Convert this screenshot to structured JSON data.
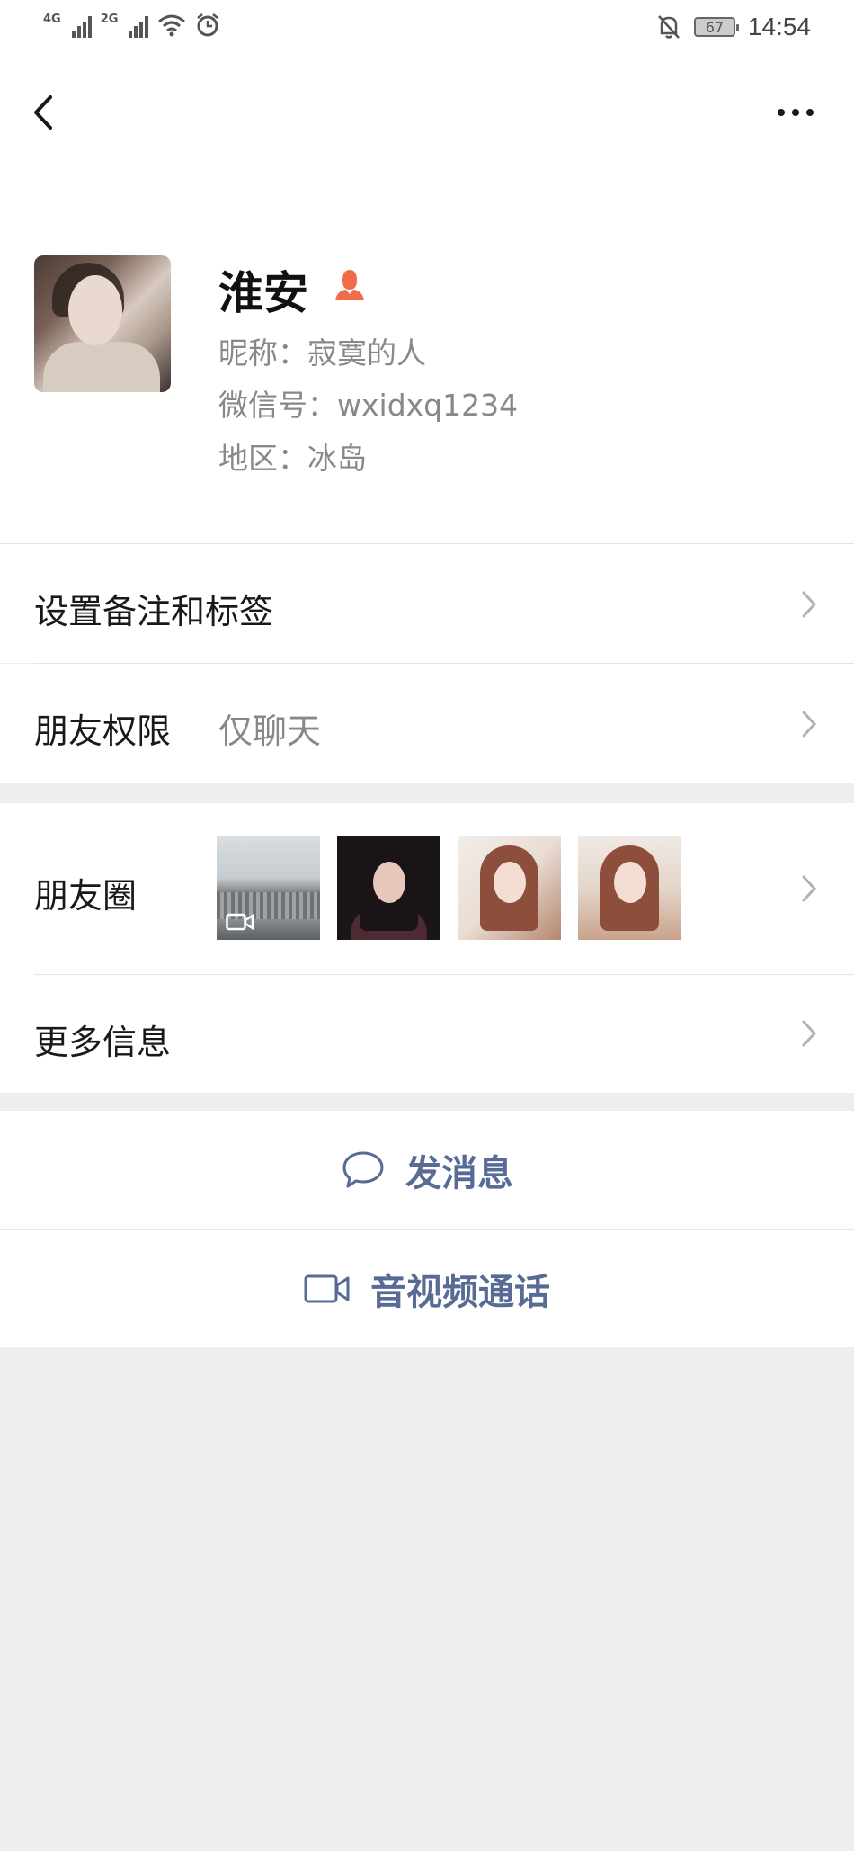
{
  "status_bar": {
    "network_1": "4G",
    "network_2": "2G",
    "battery": "67",
    "time": "14:54"
  },
  "profile": {
    "name": "淮安",
    "nickname": "昵称：寂寞的人",
    "wechat_id": "微信号：wxidxq1234",
    "region": "地区：冰岛"
  },
  "rows": {
    "remark_label": "设置备注和标签",
    "permission_label": "朋友权限",
    "permission_value": "仅聊天",
    "moments_label": "朋友圈",
    "more_info_label": "更多信息"
  },
  "actions": {
    "message": "发消息",
    "call": "音视频通话"
  },
  "colors": {
    "link": "#576b95",
    "user_icon": "#f06c4b",
    "background": "#ededed"
  },
  "icons": [
    "back-icon",
    "more-icon",
    "user-icon",
    "chevron-right-icon",
    "chat-bubble-icon",
    "video-camera-icon"
  ]
}
